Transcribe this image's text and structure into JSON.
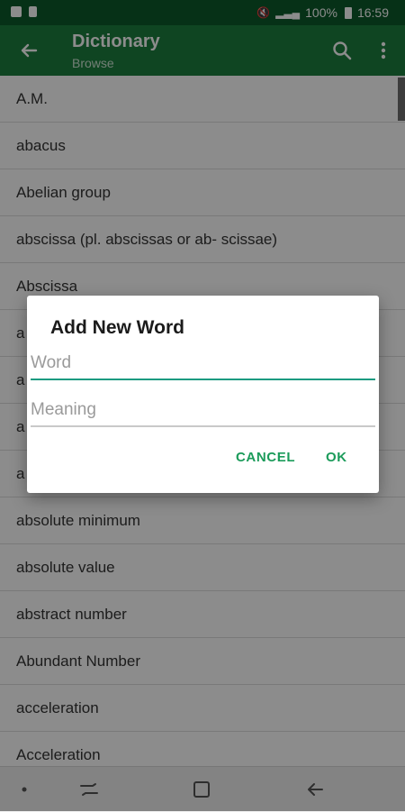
{
  "status_bar": {
    "signal_text": "100%",
    "time": "16:59"
  },
  "app_bar": {
    "title": "Dictionary",
    "subtitle": "Browse",
    "icons": [
      "back-arrow-icon",
      "search-icon",
      "more-vert-icon"
    ]
  },
  "list": {
    "items": [
      "A.M.",
      "abacus",
      "Abelian group",
      "abscissa (pl. abscissas or ab- scissae)",
      "Abscissa",
      "a",
      "a",
      "a",
      "a",
      "absolute minimum",
      "absolute value",
      "abstract number",
      "Abundant Number",
      "acceleration",
      "Acceleration"
    ]
  },
  "dialog": {
    "title": "Add New Word",
    "word_placeholder": "Word",
    "meaning_placeholder": "Meaning",
    "cancel_label": "CANCEL",
    "ok_label": "OK"
  },
  "colors": {
    "status_bar": "#0b5a2a",
    "app_bar": "#1d7f3f",
    "accent": "#1b9b5a",
    "active_field_underline": "#1b9b81"
  }
}
